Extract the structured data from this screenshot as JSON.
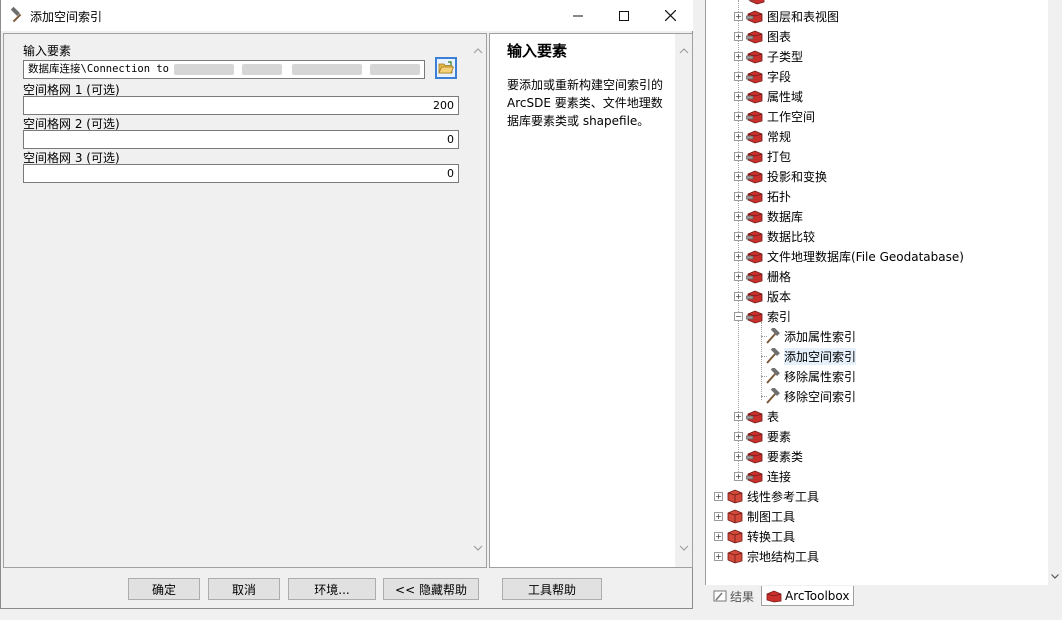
{
  "dialog": {
    "title": "添加空间索引",
    "fields": {
      "input_label": "输入要素",
      "input_value": "数据库连接\\Connection to",
      "grid1_label": "空间格网 1 (可选)",
      "grid1_value": "200",
      "grid2_label": "空间格网 2 (可选)",
      "grid2_value": "0",
      "grid3_label": "空间格网 3 (可选)",
      "grid3_value": "0"
    },
    "help": {
      "title": "输入要素",
      "text": "要添加或重新构建空间索引的 ArcSDE 要素类、文件地理数据库要素类或 shapefile。"
    },
    "buttons": {
      "ok": "确定",
      "cancel": "取消",
      "environments": "环境...",
      "hide_help": "<< 隐藏帮助",
      "tool_help": "工具帮助"
    }
  },
  "toolbox": {
    "items": [
      {
        "label": "图层和表视图"
      },
      {
        "label": "图表"
      },
      {
        "label": "子类型"
      },
      {
        "label": "字段"
      },
      {
        "label": "属性域"
      },
      {
        "label": "工作空间"
      },
      {
        "label": "常规"
      },
      {
        "label": "打包"
      },
      {
        "label": "投影和变换"
      },
      {
        "label": "拓扑"
      },
      {
        "label": "数据库"
      },
      {
        "label": "数据比较"
      },
      {
        "label": "文件地理数据库(File Geodatabase)"
      },
      {
        "label": "栅格"
      },
      {
        "label": "版本"
      },
      {
        "label": "索引"
      }
    ],
    "index_tools": [
      {
        "label": "添加属性索引"
      },
      {
        "label": "添加空间索引"
      },
      {
        "label": "移除属性索引"
      },
      {
        "label": "移除空间索引"
      }
    ],
    "items_after": [
      {
        "label": "表"
      },
      {
        "label": "要素"
      },
      {
        "label": "要素类"
      },
      {
        "label": "连接"
      }
    ],
    "top_level": [
      {
        "label": "线性参考工具"
      },
      {
        "label": "制图工具"
      },
      {
        "label": "转换工具"
      },
      {
        "label": "宗地结构工具"
      }
    ]
  },
  "tabs": {
    "results": "结果",
    "arctoolbox": "ArcToolbox"
  }
}
